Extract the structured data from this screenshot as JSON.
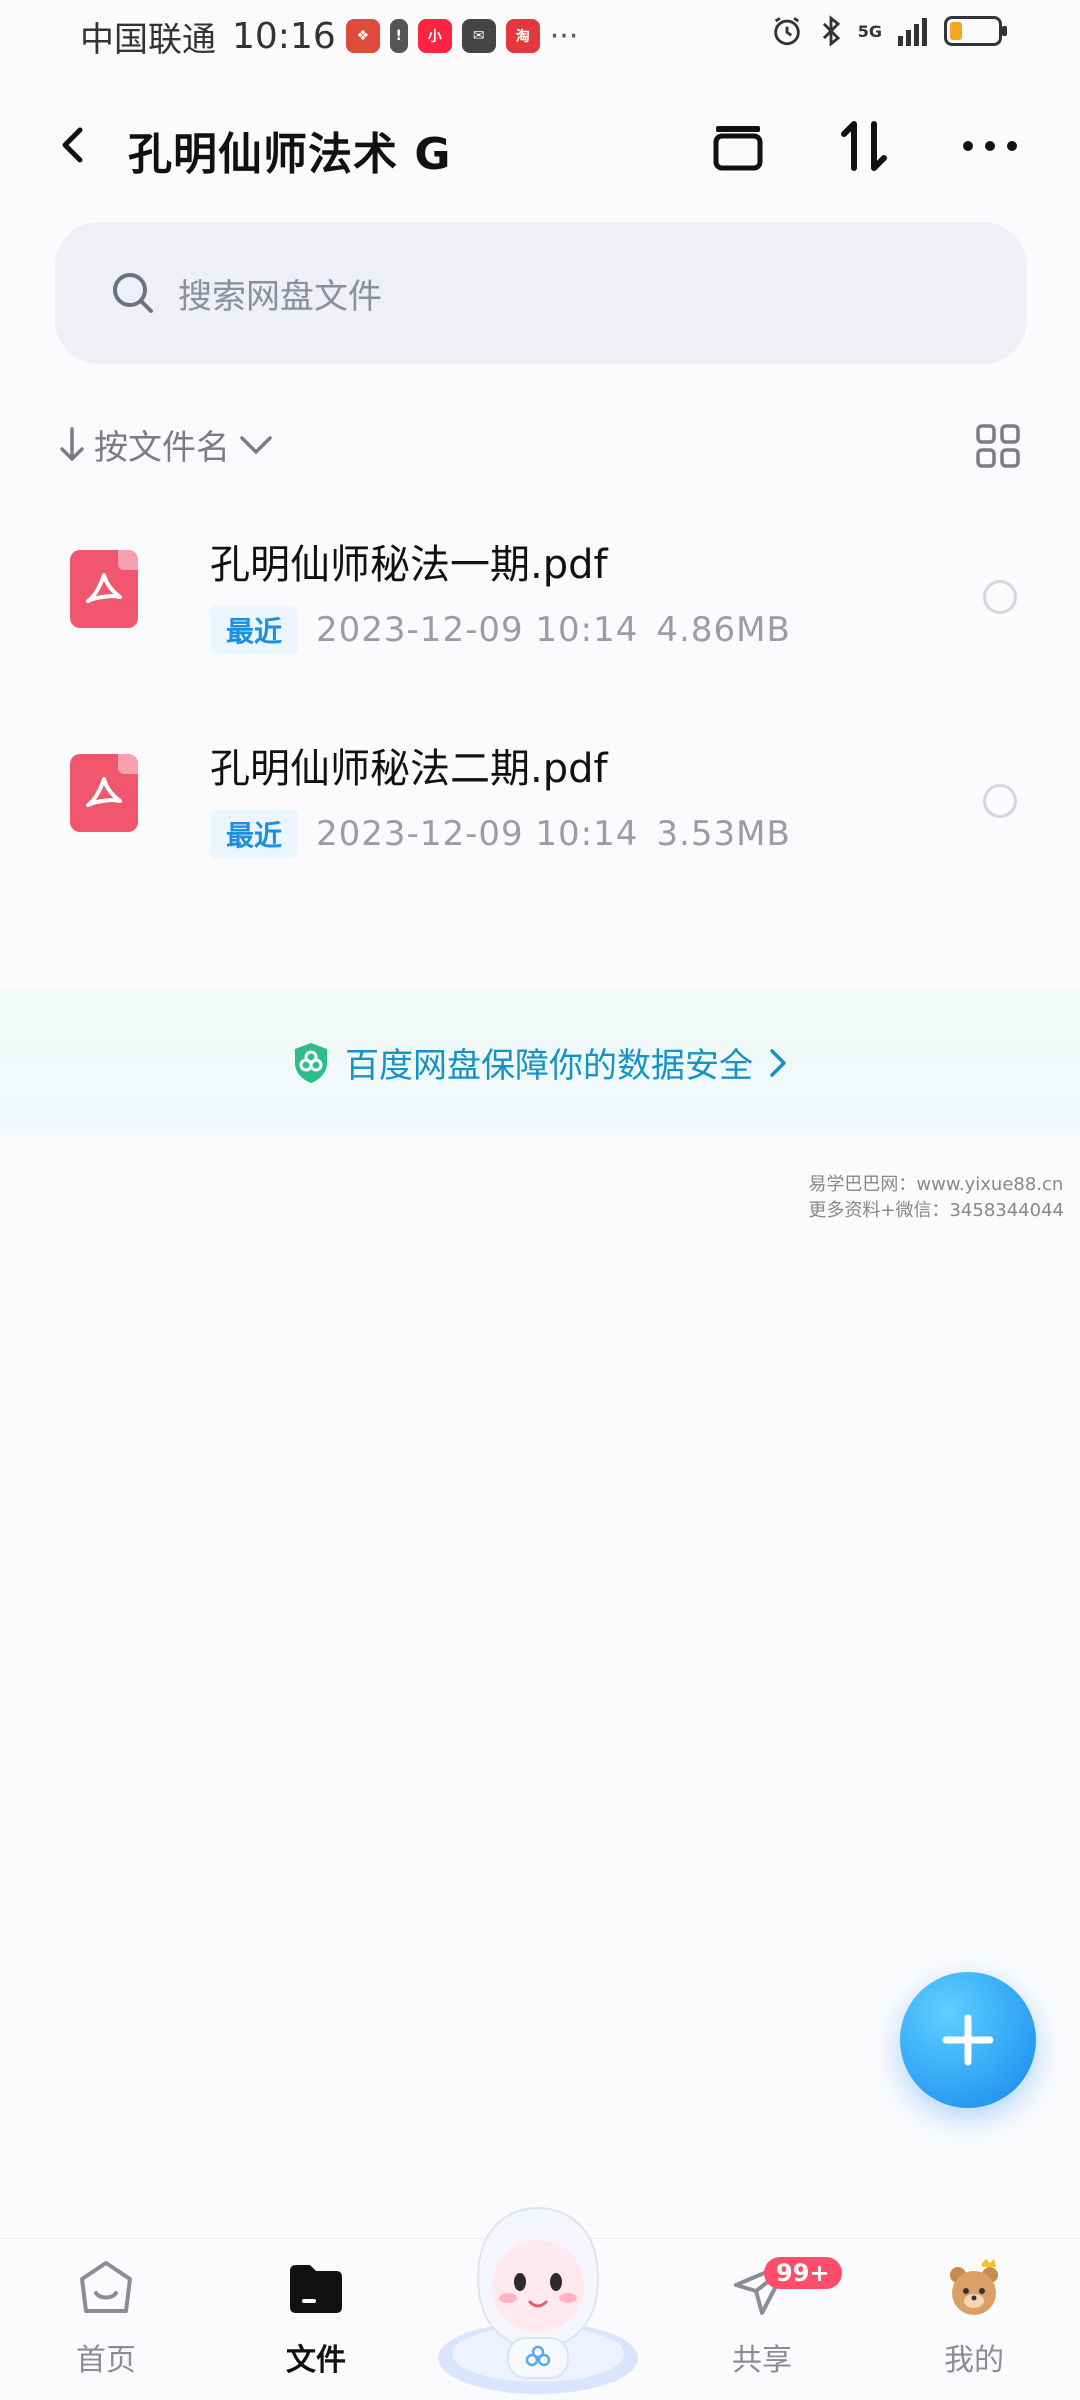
{
  "status_bar": {
    "carrier": "中国联通",
    "time": "10:16",
    "more": "···",
    "network": "5G"
  },
  "header": {
    "title": "孔明仙师法术  G"
  },
  "search": {
    "placeholder": "搜索网盘文件"
  },
  "sort": {
    "label": "按文件名"
  },
  "files": [
    {
      "name": "孔明仙师秘法一期.pdf",
      "tag": "最近",
      "datetime": "2023-12-09  10:14",
      "size": "4.86MB"
    },
    {
      "name": "孔明仙师秘法二期.pdf",
      "tag": "最近",
      "datetime": "2023-12-09  10:14",
      "size": "3.53MB"
    }
  ],
  "security_banner": {
    "text": "百度网盘保障你的数据安全"
  },
  "watermark": {
    "line1": "易学巴巴网：www.yixue88.cn",
    "line2": "更多资料+微信：3458344044"
  },
  "bottom_nav": {
    "items": [
      {
        "label": "首页"
      },
      {
        "label": "文件"
      },
      {
        "label": "共享",
        "badge": "99+"
      },
      {
        "label": "我的"
      }
    ]
  },
  "colors": {
    "accent": "#2a9df4",
    "pdf_red": "#f0566d",
    "banner_text": "#1593c6",
    "badge": "#ff4d6a"
  }
}
